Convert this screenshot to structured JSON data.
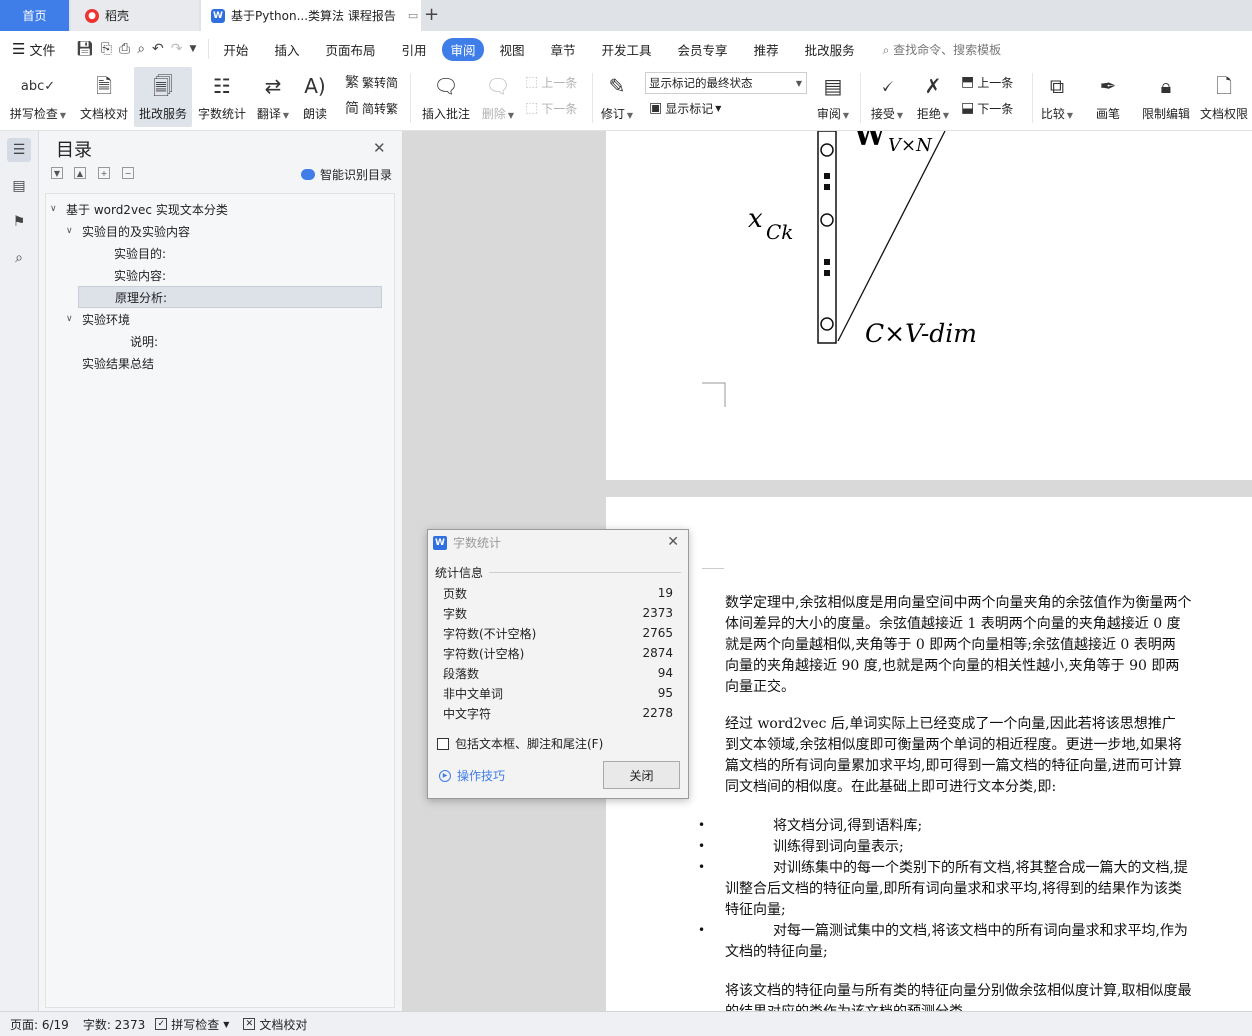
{
  "tabs": {
    "home": "首页",
    "daoke": "稻壳",
    "document": "基于Python...类算法 课程报告"
  },
  "menubar": {
    "file": "文件",
    "items": [
      "开始",
      "插入",
      "页面布局",
      "引用",
      "审阅",
      "视图",
      "章节",
      "开发工具",
      "会员专享",
      "推荐",
      "批改服务"
    ],
    "active_item": "审阅",
    "search": "查找命令、搜索模板"
  },
  "ribbon": {
    "spellcheck": "拼写检查",
    "doc_proof": "文档校对",
    "review_service": "批改服务",
    "word_count": "字数统计",
    "translate": "翻译",
    "read_aloud": "朗读",
    "to_traditional": "繁转简",
    "to_simplified": "简转繁",
    "insert_comment": "插入批注",
    "delete": "删除",
    "prev": "上一条",
    "next": "下一条",
    "revise": "修订",
    "markup_state": "显示标记的最终状态",
    "show_markup": "显示标记",
    "review": "审阅",
    "accept": "接受",
    "reject": "拒绝",
    "prev2": "上一条",
    "next2": "下一条",
    "compare": "比较",
    "ink": "画笔",
    "restrict_edit": "限制编辑",
    "doc_permission": "文档权限"
  },
  "toc": {
    "title": "目录",
    "smart": "智能识别目录",
    "items": [
      {
        "label": "基于 word2vec 实现文本分类",
        "level": 1,
        "arrow": "expanded"
      },
      {
        "label": "实验目的及实验内容",
        "level": 2,
        "arrow": "expanded"
      },
      {
        "label": "实验目的:",
        "level": 3,
        "arrow": "none"
      },
      {
        "label": "实验内容:",
        "level": 3,
        "arrow": "none"
      },
      {
        "label": "原理分析:",
        "level": 3,
        "arrow": "none",
        "selected": true
      },
      {
        "label": "实验环境",
        "level": 2,
        "arrow": "expanded"
      },
      {
        "label": "说明:",
        "level": 4,
        "arrow": "none"
      },
      {
        "label": "实验结果总结",
        "level": 2,
        "arrow": "none"
      }
    ]
  },
  "figure": {
    "weight_label": "W",
    "weight_sub": "V×N",
    "input_label": "x",
    "input_sub": "Ck",
    "dim_label": "C×V-dim"
  },
  "document": {
    "paragraphs": [
      [
        "数学定理中,余弦相似度是用向量空间中两个向量夹角的余弦值作为衡量两个",
        "体间差异的大小的度量。余弦值越接近 1 表明两个向量的夹角越接近 0 度",
        "就是两个向量越相似,夹角等于 0 即两个向量相等;余弦值越接近 0 表明两",
        "向量的夹角越接近 90 度,也就是两个向量的相关性越小,夹角等于 90 即两",
        "向量正交。"
      ],
      [
        "经过 word2vec 后,单词实际上已经变成了一个向量,因此若将该思想推广",
        "到文本领域,余弦相似度即可衡量两个单词的相近程度。更进一步地,如果将",
        "篇文档的所有词向量累加求平均,即可得到一篇文档的特征向量,进而可计算",
        "同文档间的相似度。在此基础上即可进行文本分类,即:"
      ]
    ],
    "bullets": [
      [
        "将文档分词,得到语料库;"
      ],
      [
        "训练得到词向量表示;"
      ],
      [
        "对训练集中的每一个类别下的所有文档,将其整合成一篇大的文档,提",
        "训整合后文档的特征向量,即所有词向量求和求平均,将得到的结果作为该类",
        "特征向量;"
      ],
      [
        "对每一篇测试集中的文档,将该文档中的所有词向量求和求平均,作为",
        "文档的特征向量;"
      ]
    ],
    "closing": [
      "将该文档的特征向量与所有类的特征向量分别做余弦相似度计算,取相似度最",
      "的结果对应的类作为该文档的预测分类"
    ]
  },
  "dialog": {
    "title": "字数统计",
    "section": "统计信息",
    "stats": [
      {
        "label": "页数",
        "value": "19"
      },
      {
        "label": "字数",
        "value": "2373"
      },
      {
        "label": "字符数(不计空格)",
        "value": "2765"
      },
      {
        "label": "字符数(计空格)",
        "value": "2874"
      },
      {
        "label": "段落数",
        "value": "94"
      },
      {
        "label": "非中文单词",
        "value": "95"
      },
      {
        "label": "中文字符",
        "value": "2278"
      }
    ],
    "checkbox": "包括文本框、脚注和尾注(F)",
    "tips": "操作技巧",
    "close": "关闭"
  },
  "statusbar": {
    "page": "页面: 6/19",
    "words": "字数: 2373",
    "spellcheck": "拼写检查",
    "proof": "文档校对"
  },
  "colors": {
    "accent": "#3f7ee8",
    "tab_home_bg": "#3f7ee8",
    "selection_bg": "#dde1e8"
  }
}
